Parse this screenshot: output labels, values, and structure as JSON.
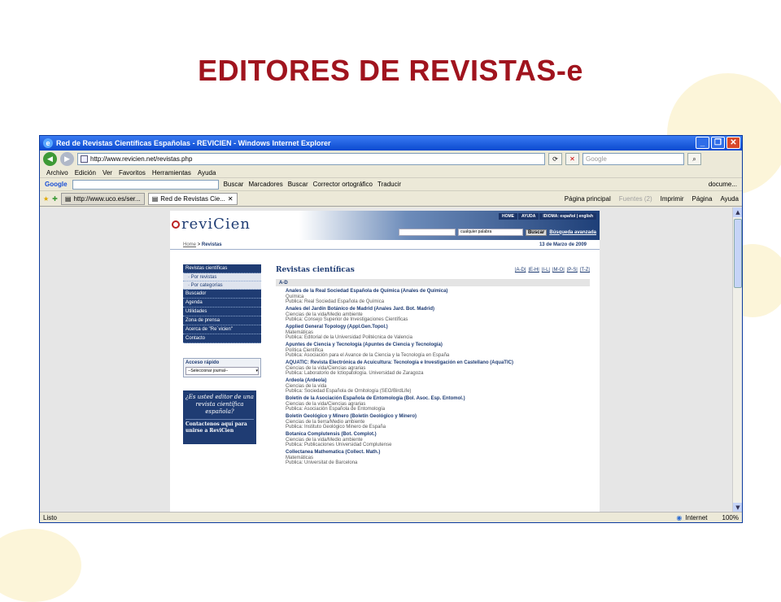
{
  "slide_title": "EDITORES DE REVISTAS-e",
  "window": {
    "title": "Red de Revistas Científicas Españolas - REVICIEN - Windows Internet Explorer",
    "address": "http://www.revicien.net/revistas.php",
    "search_placeholder": "Google",
    "menu": [
      "Archivo",
      "Edición",
      "Ver",
      "Favoritos",
      "Herramientas",
      "Ayuda"
    ]
  },
  "google_toolbar": {
    "logo": "Google",
    "items": [
      "Buscar",
      "Marcadores",
      "Buscar",
      "Corrector ortográfico",
      "Traducir",
      "docume..."
    ]
  },
  "tabs": [
    {
      "label": "http://www.uco.es/ser..."
    },
    {
      "label": "Red de Revistas Cie..."
    }
  ],
  "command_bar": [
    "Página principal",
    "Fuentes (2)",
    "Imprimir",
    "Página",
    "Ayuda"
  ],
  "status": {
    "left": "Listo",
    "zone": "Internet",
    "zoom": "100%"
  },
  "site": {
    "logo": "reviCien",
    "top_links": [
      "HOME",
      "AYUDA",
      "IDIOMA: español | english"
    ],
    "search_select": "cualquier palabra",
    "search_button": "Buscar",
    "advanced_search": "Búsqueda avanzada",
    "breadcrumb_home": "Home",
    "breadcrumb_sep": ">",
    "breadcrumb_current": "Revistas",
    "date": "13 de Marzo de 2009",
    "nav": {
      "i0": "Revistas científicas",
      "s0": "· Por revistas",
      "s1": "· Por categorías",
      "i1": "Buscador",
      "i2": "Agenda",
      "i3": "Utilidades",
      "i4": "Zona de prensa",
      "i5": "Acerca de \"Re´vicien\"",
      "i6": "Contacto"
    },
    "quick_access": {
      "label": "Acceso rápido",
      "select": "--Seleccionar journal--"
    },
    "promo": {
      "question": "¿Es usted editor de una revista científica española?",
      "cta": "Contactenos aquí para unirse a ReviCien"
    },
    "main_title": "Revistas científicas",
    "alpha_links": [
      "|A-D|",
      "|E-H|",
      "|I-L|",
      "|M-O|",
      "|P-S|",
      "|T-Z|"
    ],
    "section": "A-D",
    "journals": [
      {
        "title": "Anales de la Real Sociedad Española de Química (Anales de Química)",
        "subject": "Química",
        "publisher": "Publica: Real Sociedad Española de Química"
      },
      {
        "title": "Anales del Jardín Botánico de Madrid (Anales Jard. Bot. Madrid)",
        "subject": "Ciencias de la vida/Medio ambiente",
        "publisher": "Publica: Consejo Superior de Investigaciones Científicas"
      },
      {
        "title": "Applied General Topology (Appl.Gen.Topol.)",
        "subject": "Matemáticas",
        "publisher": "Publica: Editorial de la Universidad Politécnica de Valencia"
      },
      {
        "title": "Apuntes de Ciencia y Tecnología (Apuntes de Ciencia y Tecnología)",
        "subject": "Política Científica",
        "publisher": "Publica: Asociación para el Avance de la Ciencia y la Tecnología en España"
      },
      {
        "title": "AQUATIC: Revista Electrónica de Acuicultura: Tecnología e Investigación en Castellano (AquaTIC)",
        "subject": "Ciencias de la vida/Ciencias agrarias",
        "publisher": "Publica: Laboratorio de Ictiopatología. Universidad de Zaragoza"
      },
      {
        "title": "Ardeola (Ardeola)",
        "subject": "Ciencias de la vida",
        "publisher": "Publica: Sociedad Española de Ornitología (SEO/BirdLife)"
      },
      {
        "title": "Boletín de la Asociación Española de Entomología (Bol. Asoc. Esp. Entomol.)",
        "subject": "Ciencias de la vida/Ciencias agrarias",
        "publisher": "Publica: Asociación Española de Entomología"
      },
      {
        "title": "Boletín Geológico y Minero (Boletín Geológico y Minero)",
        "subject": "Ciencias de la tierra/Medio ambiente",
        "publisher": "Publica: Instituto Geológico Minero de España"
      },
      {
        "title": "Botanica Complutensis (Bot. Complot.)",
        "subject": "Ciencias de la vida/Medio ambiente",
        "publisher": "Publica: Publicaciones Universidad Complutense"
      },
      {
        "title": "Collectanea Mathematica (Collect. Math.)",
        "subject": "Matemáticas",
        "publisher": "Publica: Universitat de Barcelona"
      }
    ]
  }
}
